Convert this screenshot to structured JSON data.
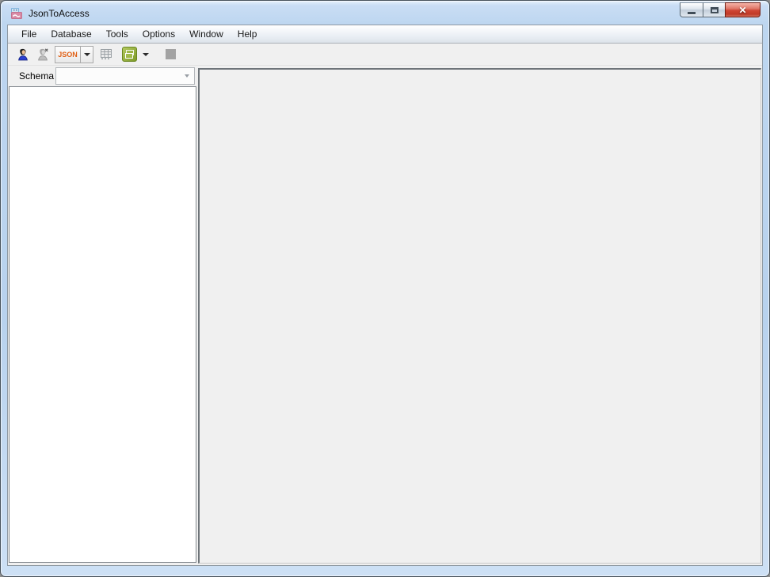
{
  "window": {
    "title": "JsonToAccess",
    "controls": {
      "minimize": "minimize",
      "maximize": "maximize",
      "close": "close",
      "close_glyph": "✕"
    }
  },
  "menu": {
    "items": [
      "File",
      "Database",
      "Tools",
      "Options",
      "Window",
      "Help"
    ]
  },
  "toolbar": {
    "json_label": "JSON",
    "buttons": [
      {
        "name": "connect",
        "icon": "person-icon",
        "enabled": true
      },
      {
        "name": "disconnect",
        "icon": "person-x-icon",
        "enabled": false
      },
      {
        "name": "json-source",
        "icon": "json-text-badge",
        "enabled": true
      },
      {
        "name": "export-table",
        "icon": "table-icon",
        "enabled": false
      },
      {
        "name": "convert",
        "icon": "cascade-windows-icon",
        "enabled": true
      },
      {
        "name": "stop",
        "icon": "stop-square-icon",
        "enabled": false
      }
    ]
  },
  "sidebar": {
    "schema_label": "Schema",
    "schema_value": ""
  },
  "colors": {
    "titlebar_blue": "#bcd5ef",
    "json_orange": "#e05f14",
    "convert_green": "#8aa832",
    "close_red": "#ce4433",
    "panel_gray": "#f0f0f0"
  }
}
